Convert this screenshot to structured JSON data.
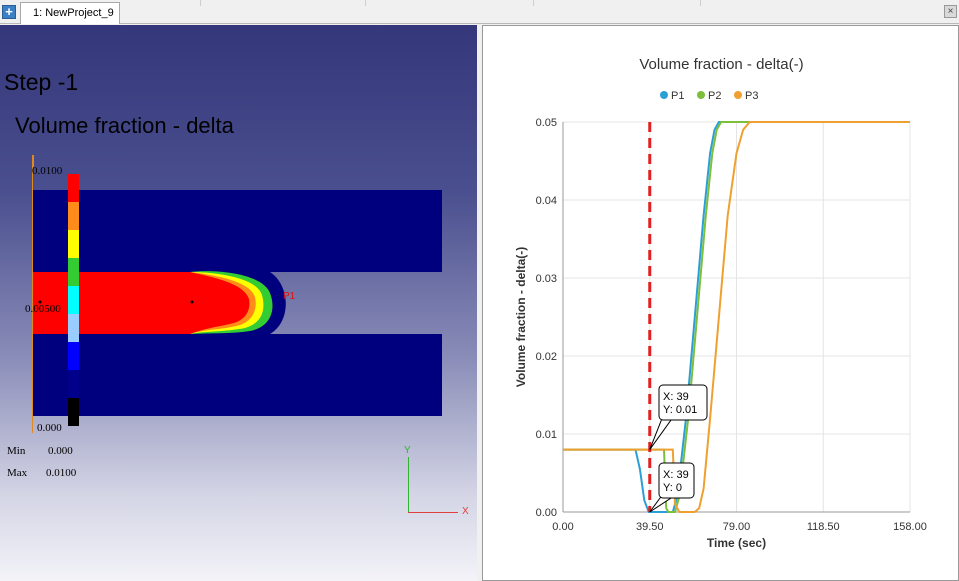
{
  "tabbar": {
    "add_icon": "plus-icon",
    "tab_label": "1: NewProject_9",
    "close_icon": "close-icon"
  },
  "viewport": {
    "step_title": "Step -1",
    "variable_title": "Volume fraction - delta",
    "legend": {
      "top_value": "0.0100",
      "mid_value": "0.00500",
      "bottom_value": "0.000",
      "colors": [
        "#ff0000",
        "#ff8c1a",
        "#ffff00",
        "#33cc33",
        "#00ffff",
        "#99ccff",
        "#0000ff",
        "#00008b",
        "#000000"
      ]
    },
    "min_label": "Min",
    "min_value": "0.000",
    "max_label": "Max",
    "max_value": "0.0100",
    "probe_label": "P1",
    "axis_y": "Y",
    "axis_x": "X",
    "colors": {
      "domain": "#00007f",
      "fluid": "#ff0000"
    }
  },
  "chart": {
    "title": "Volume fraction - delta(-)",
    "xlabel": "Time (sec)",
    "ylabel": "Volume fraction - delta(-)",
    "cursor_tooltip_1": {
      "x": "X: 39",
      "y": "Y: 0.01"
    },
    "cursor_tooltip_2": {
      "x": "X: 39",
      "y": "Y: 0"
    }
  },
  "chart_data": {
    "type": "line",
    "title": "Volume fraction - delta(-)",
    "xlabel": "Time (sec)",
    "ylabel": "Volume fraction - delta(-)",
    "xlim": [
      0,
      158
    ],
    "ylim": [
      0,
      0.05
    ],
    "x_ticks": [
      "0.00",
      "39.50",
      "79.00",
      "118.50",
      "158.00"
    ],
    "y_ticks": [
      "0.00",
      "0.01",
      "0.02",
      "0.03",
      "0.04",
      "0.05"
    ],
    "legend_position": "top",
    "grid": true,
    "cursor_x": 39.5,
    "series": [
      {
        "name": "P1",
        "color": "#2a9fd6",
        "points": [
          [
            0,
            0.008
          ],
          [
            33,
            0.008
          ],
          [
            35,
            0.0055
          ],
          [
            37,
            0.0015
          ],
          [
            39,
            0.0
          ],
          [
            45,
            0.0
          ],
          [
            50,
            0.0
          ],
          [
            52,
            0.002
          ],
          [
            56,
            0.012
          ],
          [
            60,
            0.025
          ],
          [
            64,
            0.038
          ],
          [
            67,
            0.046
          ],
          [
            69,
            0.049
          ],
          [
            71,
            0.05
          ],
          [
            158,
            0.05
          ]
        ]
      },
      {
        "name": "P2",
        "color": "#7bbf3a",
        "points": [
          [
            0,
            0.008
          ],
          [
            46,
            0.008
          ],
          [
            47,
            0.0005
          ],
          [
            48,
            0.0
          ],
          [
            51,
            0.0
          ],
          [
            53,
            0.002
          ],
          [
            57,
            0.012
          ],
          [
            61,
            0.025
          ],
          [
            65,
            0.038
          ],
          [
            68,
            0.046
          ],
          [
            70,
            0.049
          ],
          [
            72,
            0.05
          ],
          [
            158,
            0.05
          ]
        ]
      },
      {
        "name": "P3",
        "color": "#f0a030",
        "points": [
          [
            0,
            0.008
          ],
          [
            50,
            0.008
          ],
          [
            51,
            0.001
          ],
          [
            53,
            0.0
          ],
          [
            60,
            0.0
          ],
          [
            62,
            0.0005
          ],
          [
            64,
            0.003
          ],
          [
            67,
            0.012
          ],
          [
            71,
            0.025
          ],
          [
            75,
            0.038
          ],
          [
            79,
            0.046
          ],
          [
            82,
            0.049
          ],
          [
            85,
            0.05
          ],
          [
            158,
            0.05
          ]
        ]
      }
    ]
  }
}
